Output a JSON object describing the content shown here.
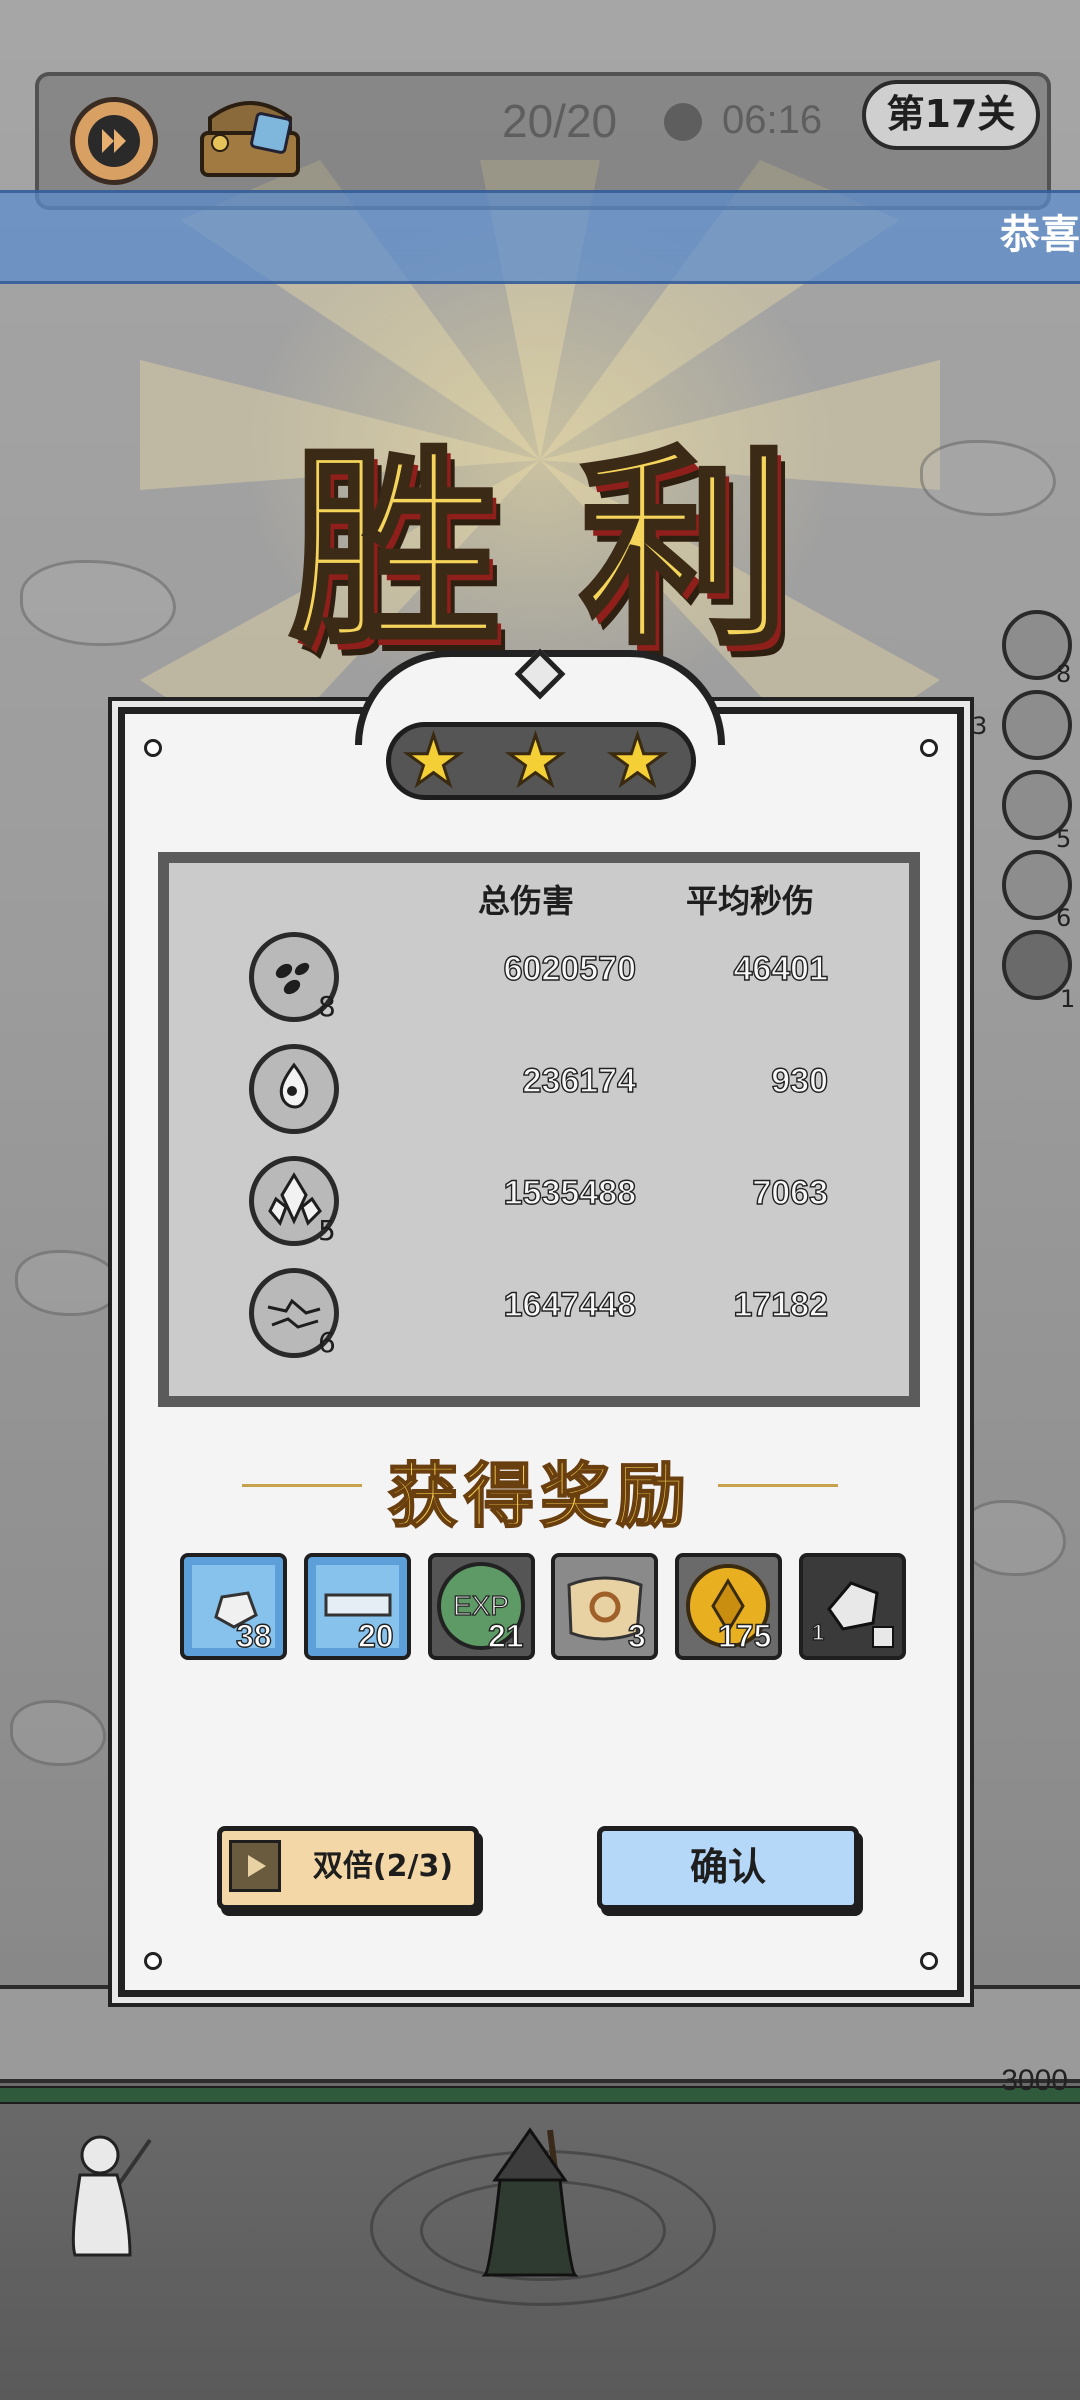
{
  "hud": {
    "wave": "20/20",
    "time": "06:16",
    "level": "第17关",
    "fast_forward_icon": "fast-forward-icon",
    "chest_icon": "treasure-chest-icon"
  },
  "banner": {
    "text": "恭喜"
  },
  "side_skills": [
    {
      "icon": "dark-drops-skill-icon",
      "count": "8"
    },
    {
      "icon": "ice-skill-icon",
      "count": "3"
    },
    {
      "icon": "crystal-skill-icon",
      "count": "5"
    },
    {
      "icon": "lightning-skill-icon",
      "count": "6"
    },
    {
      "icon": "vortex-skill-icon",
      "count": "1"
    }
  ],
  "victory_title": "胜利",
  "stars": {
    "earned": 3,
    "total": 3
  },
  "stats": {
    "headers": {
      "total_damage": "总伤害",
      "avg_dps": "平均秒伤"
    },
    "rows": [
      {
        "icon": "dark-drops-skill-icon",
        "level": "8",
        "total": "6020570",
        "dps": "46401"
      },
      {
        "icon": "water-drop-skill-icon",
        "level": "",
        "total": "236174",
        "dps": "930"
      },
      {
        "icon": "crystal-skill-icon",
        "level": "5",
        "total": "1535488",
        "dps": "7063"
      },
      {
        "icon": "lightning-skill-icon",
        "level": "6",
        "total": "1647448",
        "dps": "17182"
      }
    ]
  },
  "rewards": {
    "title": "获得奖励",
    "items": [
      {
        "icon": "ice-shard-reward-icon",
        "count": "38"
      },
      {
        "icon": "ice-scroll-reward-icon",
        "count": "20"
      },
      {
        "icon": "exp-reward-icon",
        "label": "EXP",
        "count": "21"
      },
      {
        "icon": "scroll-reward-icon",
        "count": "3"
      },
      {
        "icon": "gold-coin-reward-icon",
        "count": "175"
      },
      {
        "icon": "ore-reward-icon",
        "count": "1"
      }
    ]
  },
  "buttons": {
    "double": "双倍(2/3)",
    "confirm": "确认"
  },
  "base_hp": "3000",
  "colors": {
    "star": "#f4cf36",
    "confirm_button": "#b5d7f8",
    "double_button": "#f4d7a6",
    "banner": "#5a8ccd",
    "victory_text": "#f4d45a"
  }
}
